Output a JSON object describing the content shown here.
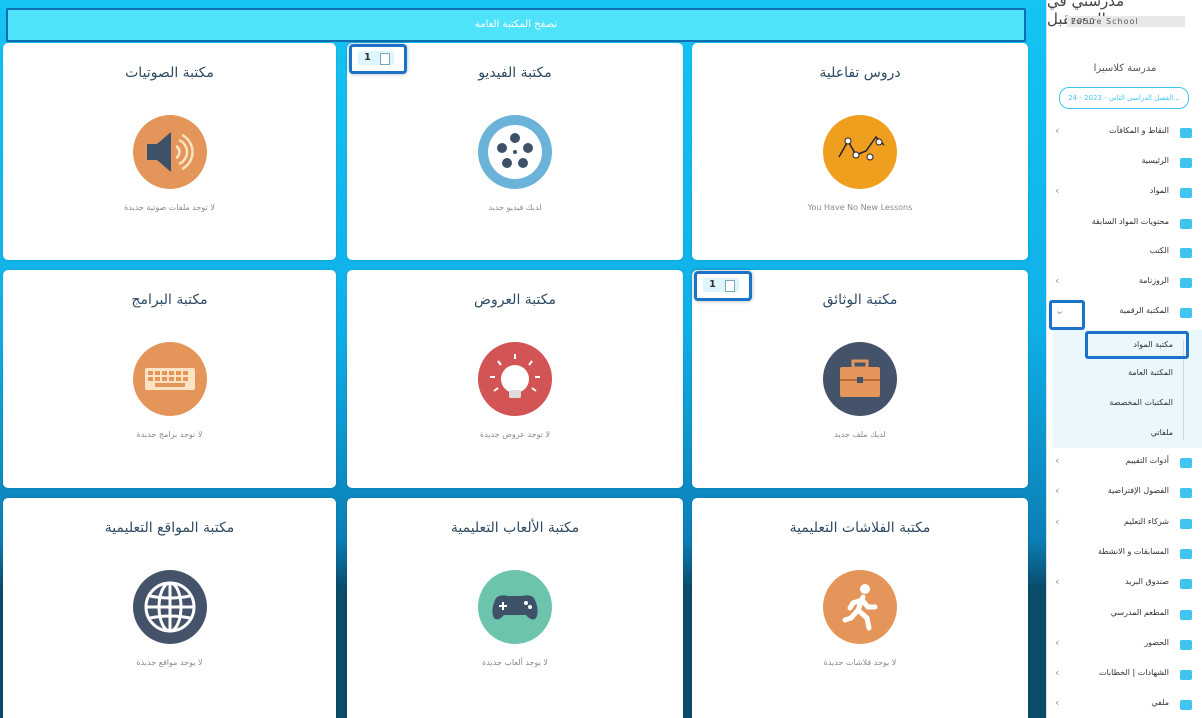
{
  "header": {
    "title": "تصفح المكتبة العامة"
  },
  "cards": [
    {
      "title": "دروس تفاعلية",
      "subtitle": "You Have No New Lessons",
      "icon": "line-chart-icon",
      "color": "#f09e1e"
    },
    {
      "title": "مكتبة الفيديو",
      "subtitle": "لديك فيديو جديد",
      "icon": "film-reel-icon",
      "color": "#6bb3d9",
      "badge": "1"
    },
    {
      "title": "مكتبة الصوتيات",
      "subtitle": "لا توجد ملفات صوتية جديدة",
      "icon": "speaker-icon",
      "color": "#e4965a"
    },
    {
      "title": "مكتبة الوثائق",
      "subtitle": "لديك ملف جديد",
      "icon": "briefcase-icon",
      "color": "#44536a",
      "badge": "1"
    },
    {
      "title": "مكتبة العروض",
      "subtitle": "لا توجد عروض جديدة",
      "icon": "lightbulb-icon",
      "color": "#d25454"
    },
    {
      "title": "مكتبة البرامج",
      "subtitle": "لا توجد برامج جديدة",
      "icon": "keyboard-icon",
      "color": "#e4965a"
    },
    {
      "title": "مكتبة الفلاشات التعليمية",
      "subtitle": "لا يوجد فلاشات جديدة",
      "icon": "running-man-icon",
      "color": "#e4965a"
    },
    {
      "title": "مكتبة الألعاب التعليمية",
      "subtitle": "لا يوجد ألعاب جديدة",
      "icon": "gamepad-icon",
      "color": "#6cc4ac"
    },
    {
      "title": "مكتبة المواقع التعليمية",
      "subtitle": "لا يوجد مواقع جديدة",
      "icon": "globe-icon",
      "color": "#44536a"
    }
  ],
  "sidebar": {
    "logo_ar": "مدرستي في المستقبل",
    "logo_en": "Future School",
    "logo_year": "2050",
    "school": "مدرسة كلاسيرا",
    "term": "الفصل الدراسي الثاني - 2023 - 24...",
    "items": [
      {
        "label": "النقاط و المكافآت",
        "icon": "gift-icon",
        "chevron": true
      },
      {
        "label": "الرئيسية",
        "icon": "home-icon",
        "chevron": false
      },
      {
        "label": "المواد",
        "icon": "briefcase-icon",
        "chevron": true
      },
      {
        "label": "محتويات المواد السابقة",
        "icon": "briefcase-icon",
        "chevron": false
      },
      {
        "label": "الكتب",
        "icon": "book-icon",
        "chevron": false
      },
      {
        "label": "الروزنامة",
        "icon": "calendar-icon",
        "chevron": true
      },
      {
        "label": "المكتبة الرقمية",
        "icon": "library-icon",
        "chevron": true
      },
      {
        "label": "أدوات التقييم",
        "icon": "checkbox-icon",
        "chevron": true
      },
      {
        "label": "الفصول الإفتراضية",
        "icon": "headphones-icon",
        "chevron": true
      },
      {
        "label": "شركاء التعليم",
        "icon": "handshake-icon",
        "chevron": true
      },
      {
        "label": "المسابقات و الانشطة",
        "icon": "trophy-icon",
        "chevron": false
      },
      {
        "label": "صندوق البريد",
        "icon": "mail-icon",
        "chevron": true
      },
      {
        "label": "المطعم المدرسي",
        "icon": "restaurant-icon",
        "chevron": false
      },
      {
        "label": "الحضور",
        "icon": "attendance-icon",
        "chevron": true
      },
      {
        "label": "الشهادات | الخطابات",
        "icon": "qr-icon",
        "chevron": true
      },
      {
        "label": "ملفي",
        "icon": "user-icon",
        "chevron": true
      }
    ],
    "submenu": [
      "مكتبة المواد",
      "المكتبة العامة",
      "المكتبات المخصصة",
      "ملفاتي"
    ]
  }
}
